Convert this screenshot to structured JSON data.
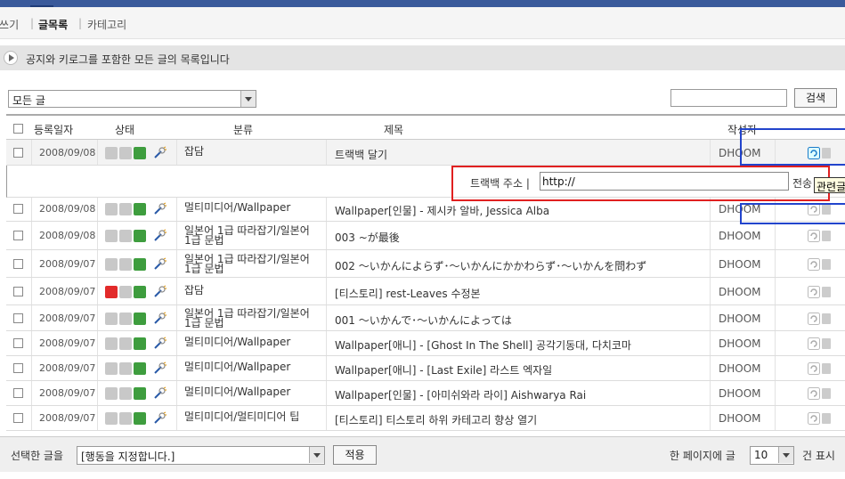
{
  "nav": {
    "write": "글쓰기",
    "list": "글목록",
    "category": "카테고리",
    "sep1": "|",
    "sep2": "|"
  },
  "notice": "공지와 키로그를 포함한 모든 글의 목록입니다",
  "filter": {
    "selected": "모든 글"
  },
  "search": {
    "button": "검색",
    "value": ""
  },
  "columns": {
    "date": "등록일자",
    "status": "상태",
    "category": "분류",
    "title": "제목",
    "author": "작성자"
  },
  "rows": [
    {
      "date": "2008/09/08",
      "category": "잡담",
      "title": "트랙백 달기",
      "author": "DHOOM",
      "locked": false
    },
    {
      "date": "2008/09/08",
      "category": "멀티미디어/Wallpaper",
      "title": "Wallpaper[인물] - 제시카 알바, Jessica Alba",
      "author": "DHOOM",
      "locked": false
    },
    {
      "date": "2008/09/08",
      "category": "일본어 1급 따라잡기/일본어 1급 문법",
      "title": "003 ~が最後",
      "author": "DHOOM",
      "locked": false
    },
    {
      "date": "2008/09/07",
      "category": "일본어 1급 따라잡기/일본어 1급 문법",
      "title": "002 ～いかんによらず･～いかんにかかわらず･～いかんを問わず",
      "author": "DHOOM",
      "locked": false
    },
    {
      "date": "2008/09/07",
      "category": "잡담",
      "title": "[티스토리] rest-Leaves 수정본",
      "author": "DHOOM",
      "locked": true
    },
    {
      "date": "2008/09/07",
      "category": "일본어 1급 따라잡기/일본어 1급 문법",
      "title": "001 ～いかんで･～いかんによっては",
      "author": "DHOOM",
      "locked": false
    },
    {
      "date": "2008/09/07",
      "category": "멀티미디어/Wallpaper",
      "title": "Wallpaper[애니] - [Ghost In The Shell] 공각기동대, 다치코마",
      "author": "DHOOM",
      "locked": false
    },
    {
      "date": "2008/09/07",
      "category": "멀티미디어/Wallpaper",
      "title": "Wallpaper[애니] - [Last Exile] 라스트 엑자일",
      "author": "DHOOM",
      "locked": false
    },
    {
      "date": "2008/09/07",
      "category": "멀티미디어/Wallpaper",
      "title": "Wallpaper[인물] - [아미쉬와라 라이] Aishwarya Rai",
      "author": "DHOOM",
      "locked": false
    },
    {
      "date": "2008/09/07",
      "category": "멀티미디어/멀티미디어 팁",
      "title": "[티스토리] 티스토리 하위 카테고리 향상 열기",
      "author": "DHOOM",
      "locked": false
    }
  ],
  "trackback": {
    "label": "트랙백 주소 |",
    "value": "http://",
    "send": "전송"
  },
  "tooltip": "관련글",
  "footer": {
    "selected_label": "선택한 글을",
    "action_select": "[행동을 지정합니다.]",
    "apply": "적용",
    "per_page_label": "한 페이지에 글",
    "per_page_value": "10",
    "per_page_suffix": "건 표시"
  }
}
